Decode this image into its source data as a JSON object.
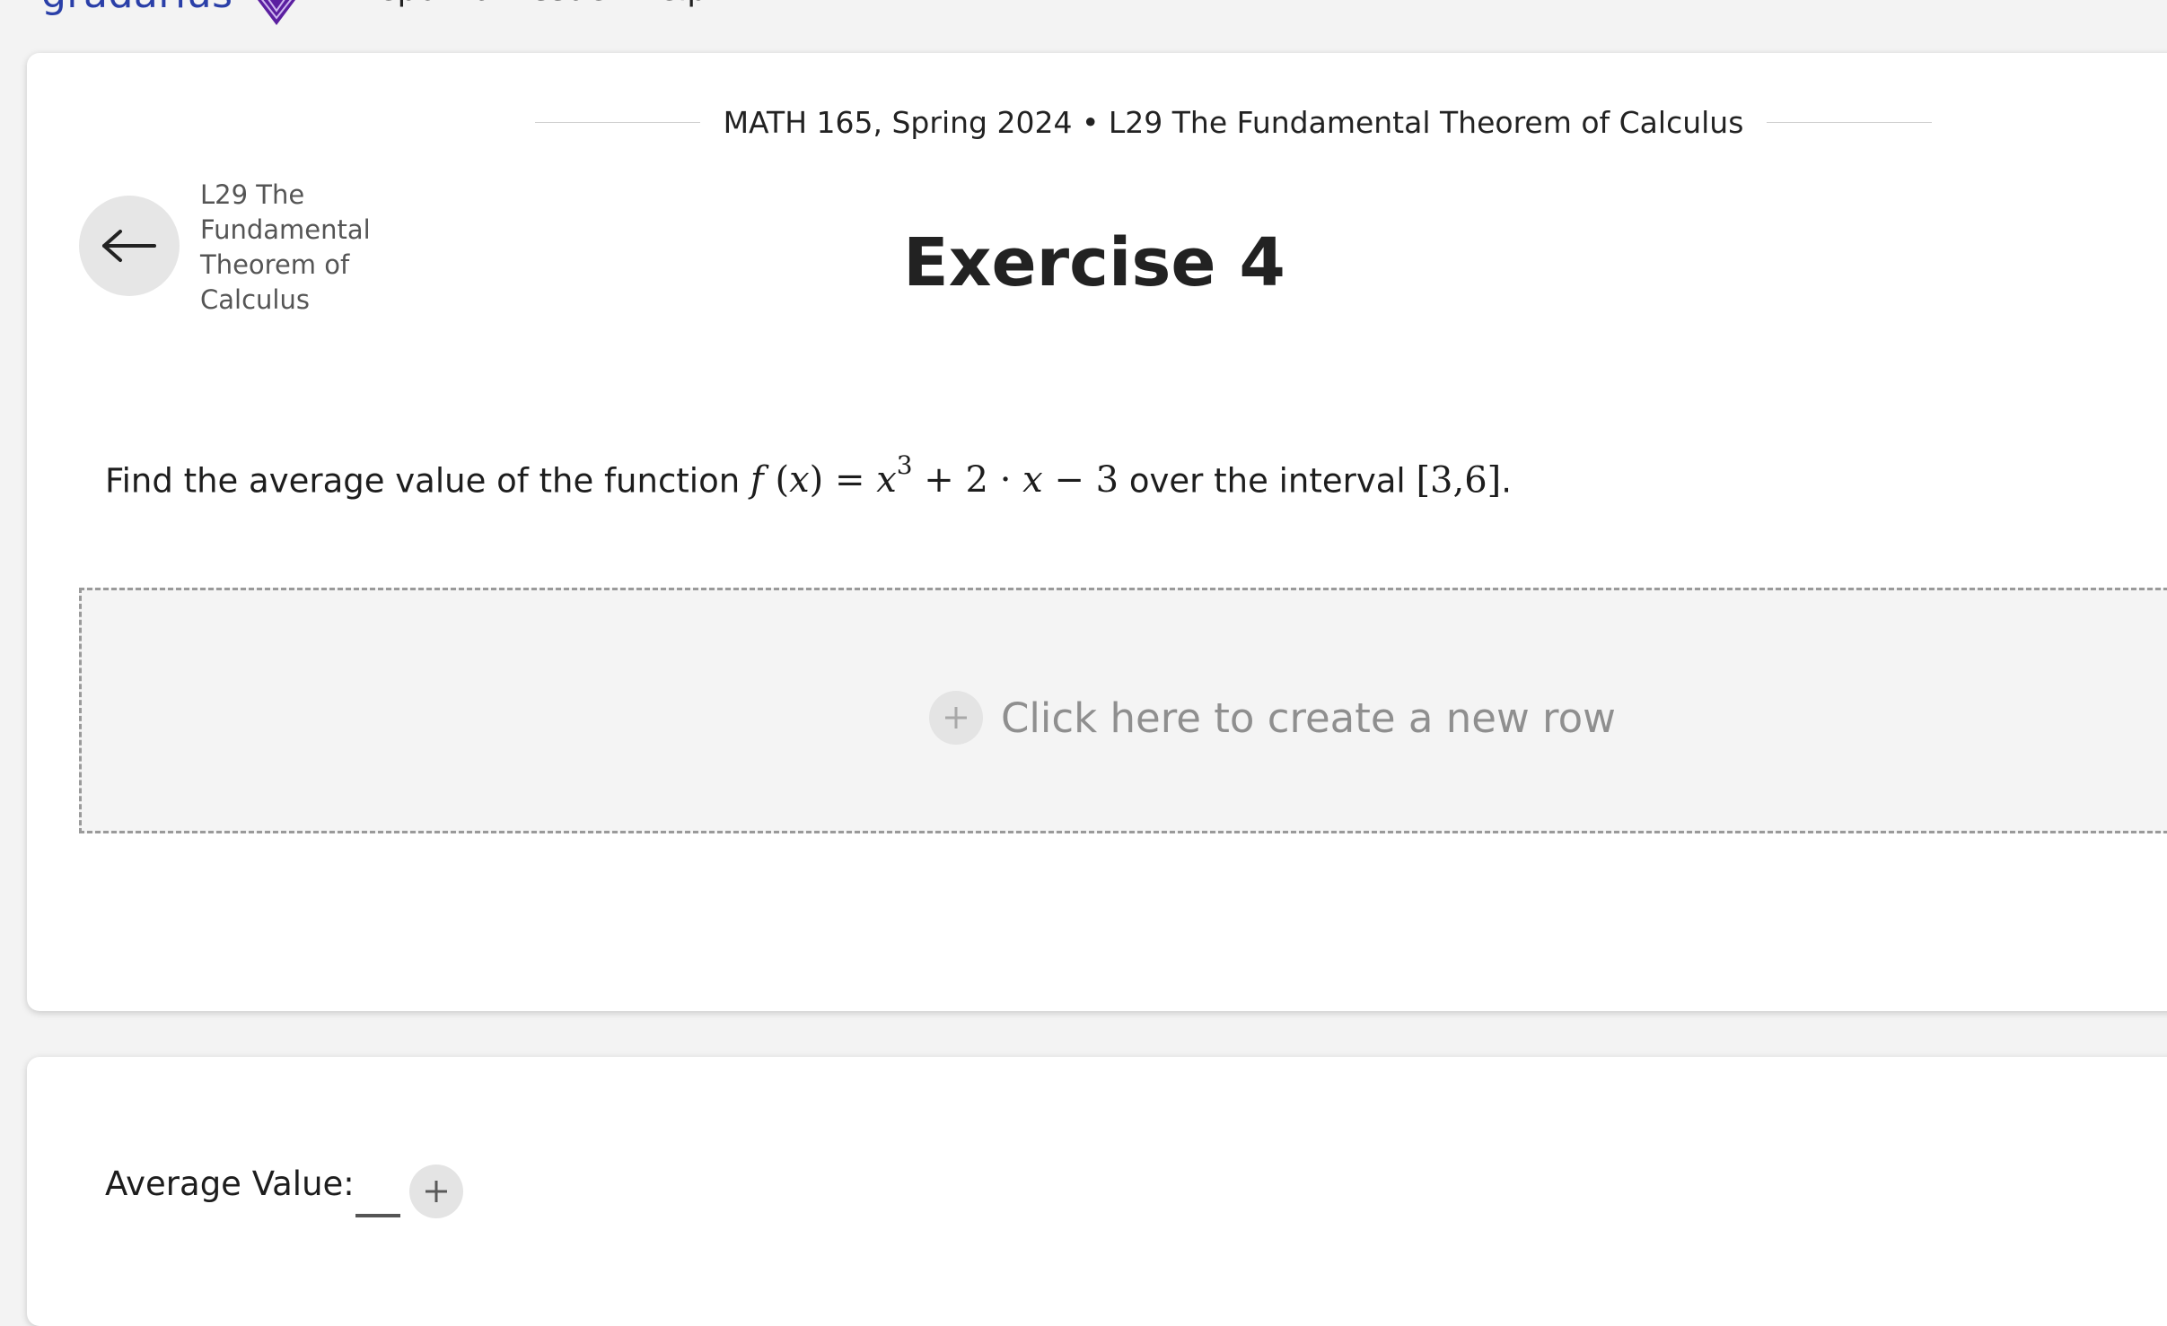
{
  "header": {
    "brand": "gradarius",
    "nav": [
      "Report an issue",
      "Help"
    ]
  },
  "breadcrumb": {
    "course": "MATH 165, Spring 2024",
    "separator": " • ",
    "lesson": "L29 The Fundamental Theorem of Calculus"
  },
  "back": {
    "label": "L29 The Fundamental Theorem of Calculus"
  },
  "exercise": {
    "title": "Exercise 4",
    "prompt_before": "Find the average value of the function ",
    "prompt_middle": " over the interval ",
    "prompt_after": ".",
    "function_text": "f(x) = x^3 + 2·x − 3",
    "interval_text": "[3,6]"
  },
  "workspace": {
    "new_row_label": "Click here to create a new row"
  },
  "answer": {
    "label": "Average Value:"
  },
  "colors": {
    "brand": "#2a3fa8",
    "logo_accent": "#5b1fa0",
    "page_background": "#f3f3f3"
  }
}
